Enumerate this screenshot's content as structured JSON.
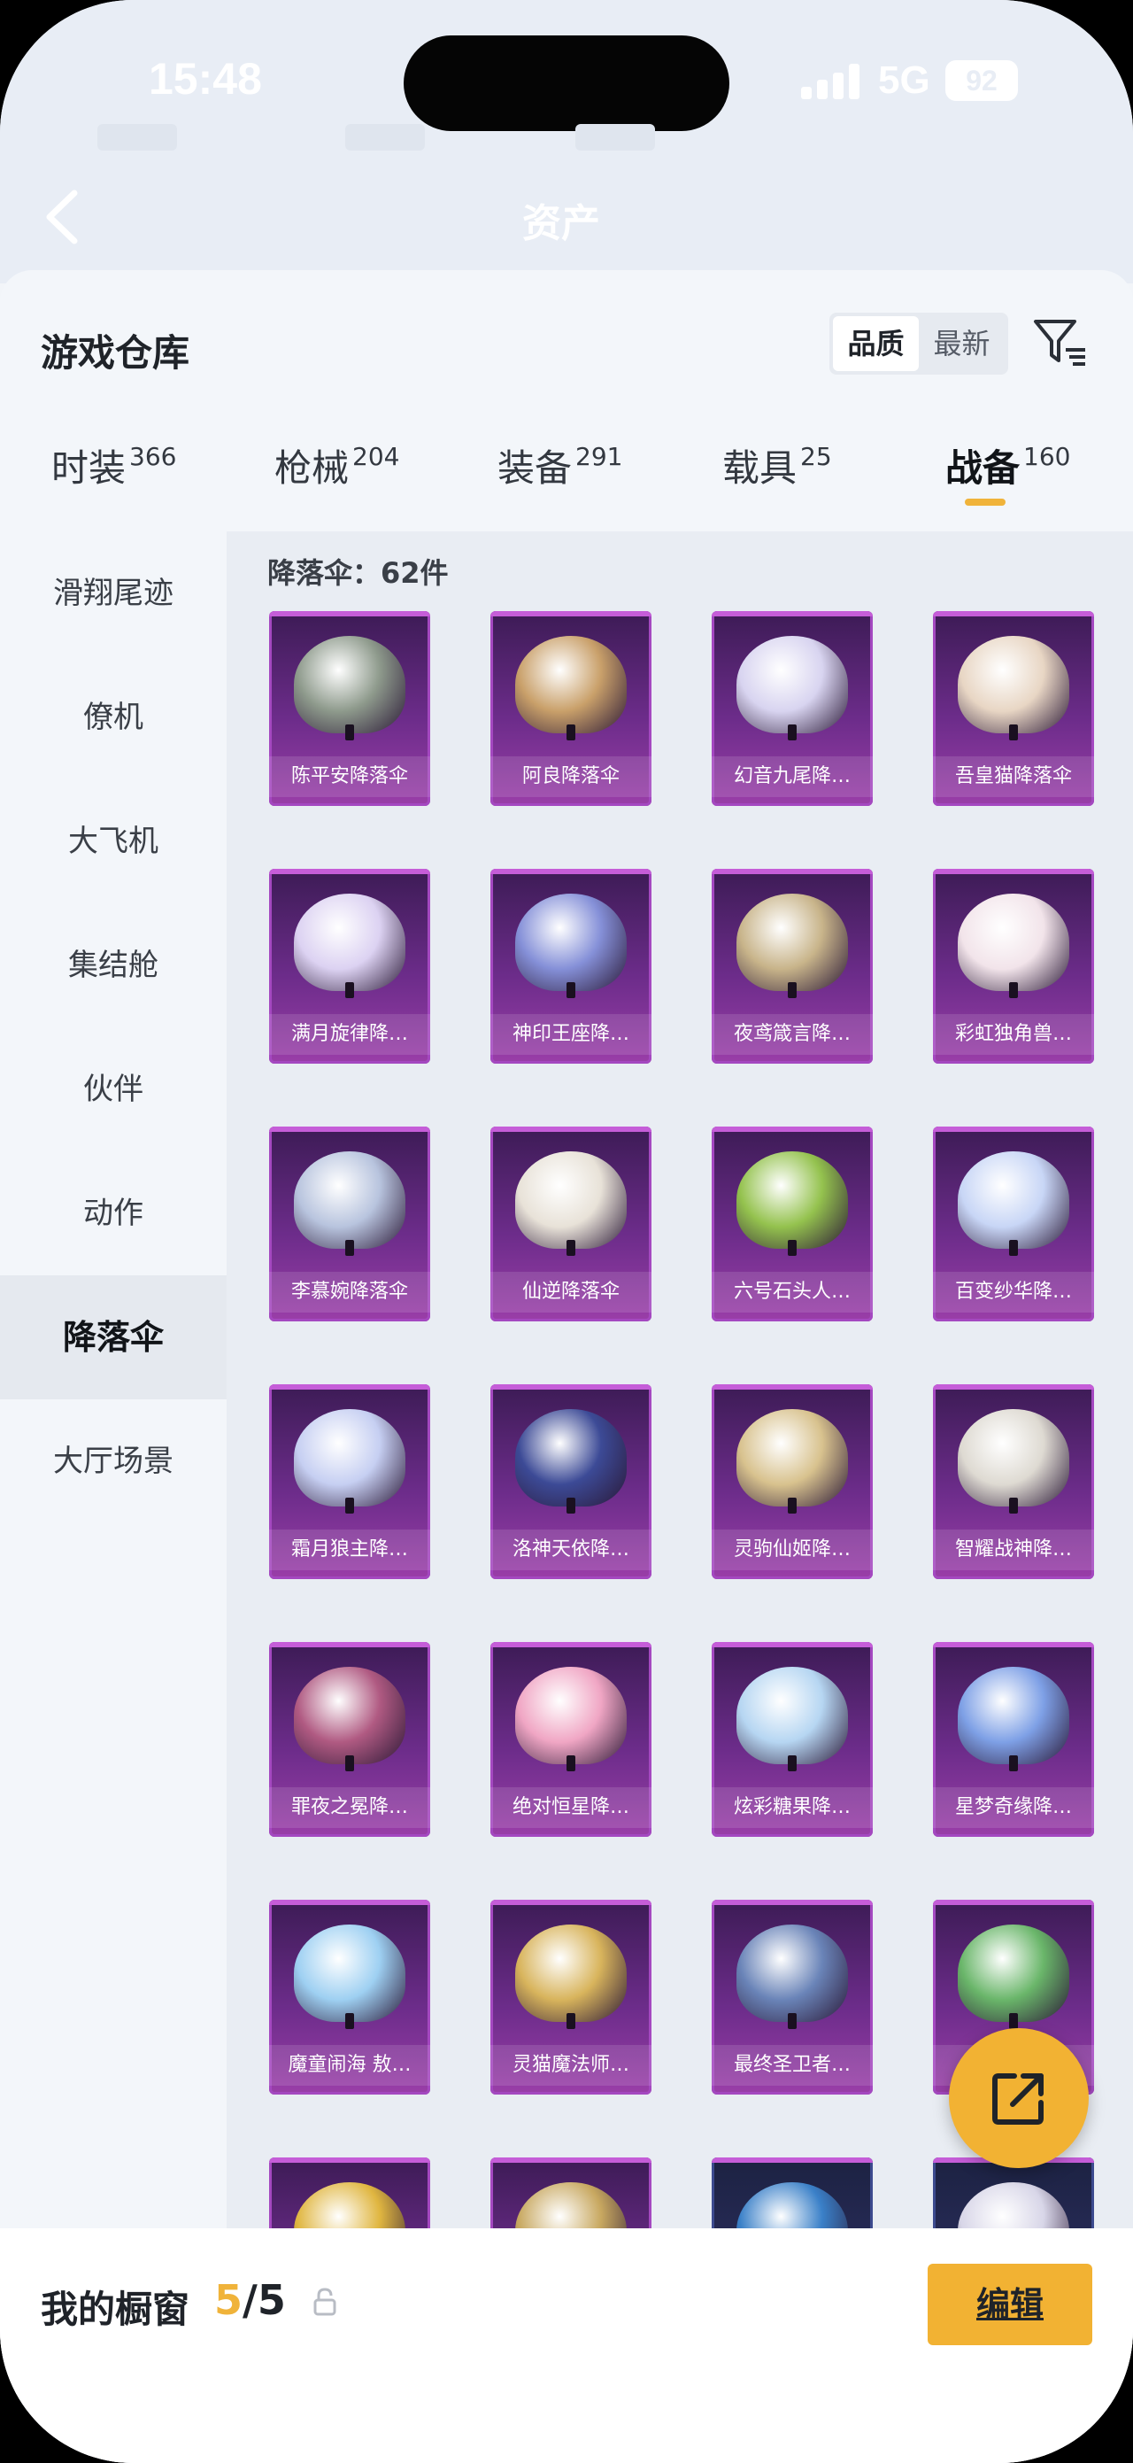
{
  "status_bar": {
    "time": "15:48",
    "network": "5G",
    "battery": "92"
  },
  "header": {
    "title": "资产"
  },
  "sheet": {
    "title": "游戏仓库",
    "sort": {
      "options": [
        "品质",
        "最新"
      ],
      "selected": "品质"
    }
  },
  "tabs": [
    {
      "label": "时装",
      "count": "366"
    },
    {
      "label": "枪械",
      "count": "204"
    },
    {
      "label": "装备",
      "count": "291"
    },
    {
      "label": "载具",
      "count": "25"
    },
    {
      "label": "战备",
      "count": "160",
      "active": true
    }
  ],
  "sidebar": {
    "items": [
      "滑翔尾迹",
      "僚机",
      "大飞机",
      "集结舱",
      "伙伴",
      "动作",
      "降落伞",
      "大厅场景"
    ],
    "active": "降落伞"
  },
  "grid": {
    "heading": "降落伞：62件",
    "items": [
      {
        "name": "陈平安降落伞",
        "color": "#8e9a8c"
      },
      {
        "name": "阿良降落伞",
        "color": "#c9a06a"
      },
      {
        "name": "幻音九尾降…",
        "color": "#d8d4f0"
      },
      {
        "name": "吾皇猫降落伞",
        "color": "#e8d6c4"
      },
      {
        "name": "满月旋律降…",
        "color": "#dcd2f2"
      },
      {
        "name": "神印王座降…",
        "color": "#8590d8"
      },
      {
        "name": "夜鸢箴言降…",
        "color": "#c8b48a"
      },
      {
        "name": "彩虹独角兽…",
        "color": "#f2e4ea"
      },
      {
        "name": "李慕婉降落伞",
        "color": "#b8c4de"
      },
      {
        "name": "仙逆降落伞",
        "color": "#e8e2d8"
      },
      {
        "name": "六号石头人…",
        "color": "#94c24e"
      },
      {
        "name": "百变纱华降…",
        "color": "#c8d6f6"
      },
      {
        "name": "霜月狼主降…",
        "color": "#c6cff2"
      },
      {
        "name": "洛神天依降…",
        "color": "#3c4a96"
      },
      {
        "name": "灵驹仙姬降…",
        "color": "#d8c28e"
      },
      {
        "name": "智耀战神降…",
        "color": "#dedad2"
      },
      {
        "name": "罪夜之冕降…",
        "color": "#b05a82"
      },
      {
        "name": "绝对恒星降…",
        "color": "#f0a6c4"
      },
      {
        "name": "炫彩糖果降…",
        "color": "#b6d6f2"
      },
      {
        "name": "星梦奇缘降…",
        "color": "#7ea0e6"
      },
      {
        "name": "魔童闹海 敖…",
        "color": "#9ed0f2"
      },
      {
        "name": "灵猫魔法师…",
        "color": "#d8b45c"
      },
      {
        "name": "最终圣卫者…",
        "color": "#6a84b8"
      },
      {
        "name": "巫",
        "color": "#6ab66a"
      },
      {
        "name": "",
        "color": "#e0b640"
      },
      {
        "name": "",
        "color": "#c8a860"
      },
      {
        "name": "",
        "color": "#3a80c8"
      },
      {
        "name": "",
        "color": "#d8d6e8"
      }
    ]
  },
  "bottom": {
    "label": "我的橱窗",
    "count_current": "5",
    "count_total": "/5",
    "edit_label": "编辑"
  }
}
